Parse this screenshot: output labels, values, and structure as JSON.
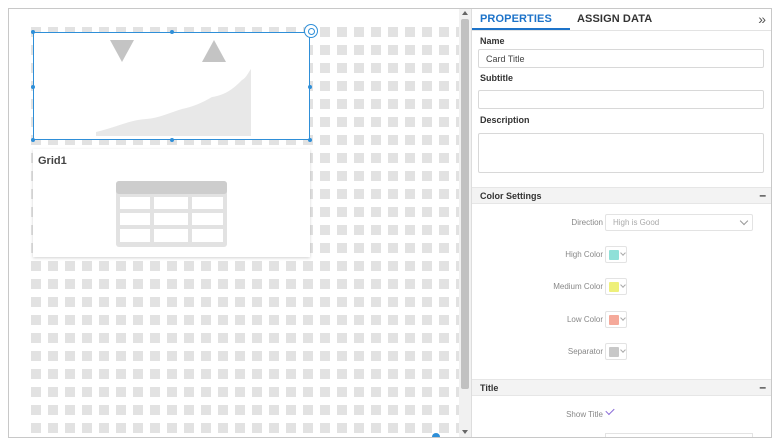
{
  "tabs": {
    "properties": "PROPERTIES",
    "assign_data": "ASSIGN DATA"
  },
  "icons": {
    "collapse": "double-chevron-right-icon",
    "gear": "gear-icon"
  },
  "canvas": {
    "grid_widget_title": "Grid1"
  },
  "fields": {
    "name_label": "Name",
    "name_value": "Card Title",
    "subtitle_label": "Subtitle",
    "subtitle_value": "",
    "description_label": "Description",
    "description_value": ""
  },
  "color_settings": {
    "title": "Color Settings",
    "direction_label": "Direction",
    "direction_value": "High is Good",
    "high_label": "High Color",
    "high_color": "#8fe0d8",
    "medium_label": "Medium Color",
    "medium_color": "#eef07a",
    "low_label": "Low Color",
    "low_color": "#f5a99a",
    "separator_label": "Separator",
    "separator_color": "#c8c8c8"
  },
  "title_section": {
    "title": "Title",
    "show_title_label": "Show Title",
    "show_title_checked": true
  },
  "colors": {
    "accent": "#1d73c9",
    "selection": "#2f8fd8"
  }
}
